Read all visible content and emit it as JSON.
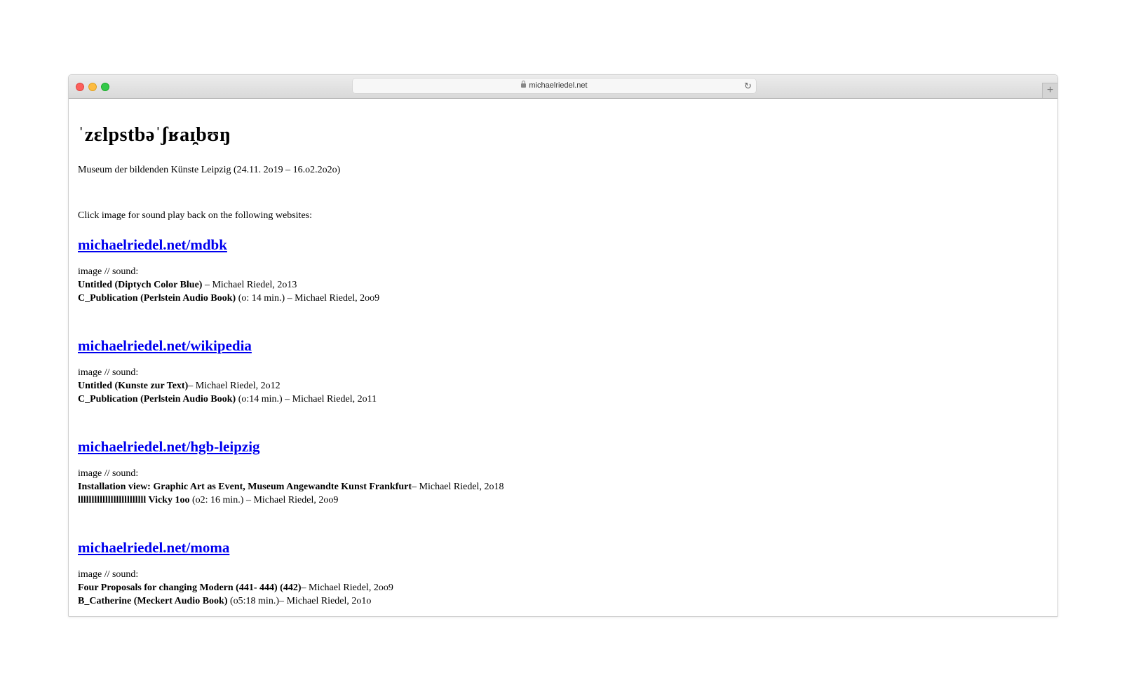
{
  "browser": {
    "url": "michaelriedel.net",
    "new_tab": "+",
    "reload": "↻"
  },
  "page": {
    "title": "ˈzɛlpstbəˈʃʁaɪ̯bʊŋ",
    "venue": "Museum der bildenden Künste Leipzig (24.11. 2o19 – 16.o2.2o2o)",
    "intro": "Click image for sound play back on the following websites:",
    "sections": [
      {
        "link": "michaelriedel.net/mdbk",
        "label": "image // sound:",
        "line1_bold": "Untitled (Diptych Color Blue)",
        "line1_rest": " – Michael Riedel, 2o13",
        "line2_bold": "C_Publication (Perlstein Audio Book)",
        "line2_rest": " (o: 14 min.) – Michael Riedel, 2oo9"
      },
      {
        "link": "michaelriedel.net/wikipedia",
        "label": "image // sound:",
        "line1_bold": "Untitled (Kunste zur Text)",
        "line1_rest": "– Michael Riedel, 2o12",
        "line2_bold": "C_Publication (Perlstein Audio Book)",
        "line2_rest": " (o:14 min.) – Michael Riedel, 2o11"
      },
      {
        "link": "michaelriedel.net/hgb-leipzig",
        "label": "image // sound:",
        "line1_bold": "Installation view: Graphic Art as Event, Museum Angewandte Kunst Frankfurt",
        "line1_rest": "– Michael Riedel, 2o18",
        "line2_bold": "lllllllllllllllllllllllll Vicky 1oo",
        "line2_rest": " (o2: 16 min.) – Michael Riedel, 2oo9"
      },
      {
        "link": "michaelriedel.net/moma",
        "label": "image // sound:",
        "line1_bold": "Four Proposals for changing Modern (441- 444) (442)",
        "line1_rest": "– Michael Riedel, 2oo9",
        "line2_bold": "B_Catherine (Meckert Audio Book)",
        "line2_rest": " (o5:18 min.)– Michael Riedel, 2o1o"
      }
    ]
  },
  "colors": {
    "link": "#0000ee",
    "close": "#fc605c",
    "minimize": "#fdbc40",
    "zoom": "#34c84a"
  }
}
